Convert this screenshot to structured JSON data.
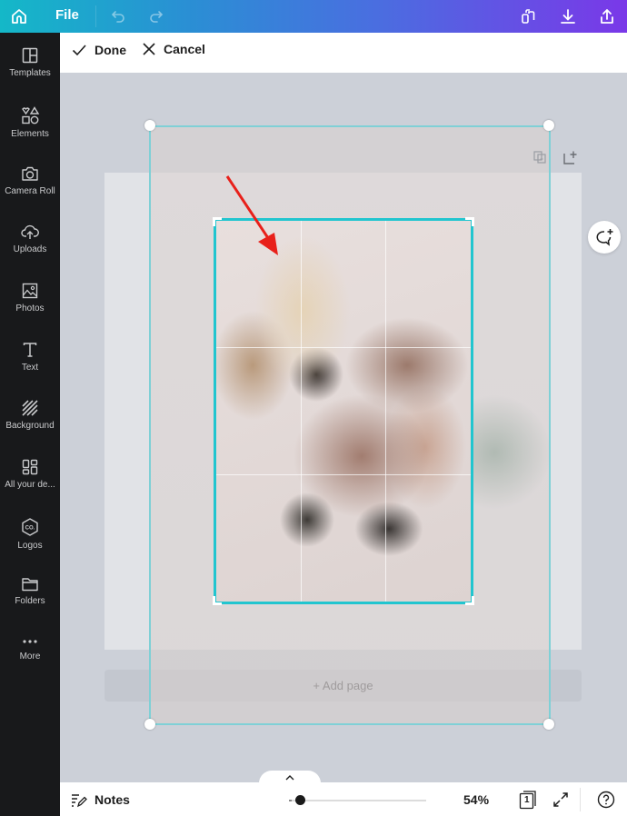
{
  "topbar": {
    "home_icon": "home-icon",
    "file_label": "File",
    "undo_icon": "undo-icon",
    "redo_icon": "redo-icon",
    "copy_icon": "duplicate-design-icon",
    "download_icon": "download-icon",
    "share_icon": "share-icon",
    "gradient_start": "#14b8c8",
    "gradient_end": "#7a38e8"
  },
  "sidebar": {
    "items": [
      {
        "label": "Templates",
        "icon": "templates-icon"
      },
      {
        "label": "Elements",
        "icon": "elements-icon"
      },
      {
        "label": "Camera Roll",
        "icon": "camera-icon"
      },
      {
        "label": "Uploads",
        "icon": "upload-cloud-icon"
      },
      {
        "label": "Photos",
        "icon": "photos-icon"
      },
      {
        "label": "Text",
        "icon": "text-icon"
      },
      {
        "label": "Background",
        "icon": "background-icon"
      },
      {
        "label": "All your de...",
        "icon": "all-designs-icon"
      },
      {
        "label": "Logos",
        "icon": "logos-icon"
      },
      {
        "label": "Folders",
        "icon": "folder-icon"
      },
      {
        "label": "More",
        "icon": "more-icon"
      }
    ]
  },
  "crop_toolbar": {
    "done_label": "Done",
    "cancel_label": "Cancel"
  },
  "canvas": {
    "add_page_label": "+ Add page",
    "crop_accent": "#21c5cf",
    "annotation_arrow_color": "#e8201a"
  },
  "bottombar": {
    "notes_label": "Notes",
    "zoom_value": "54%",
    "zoom_percent": 54,
    "page_count": "1"
  }
}
